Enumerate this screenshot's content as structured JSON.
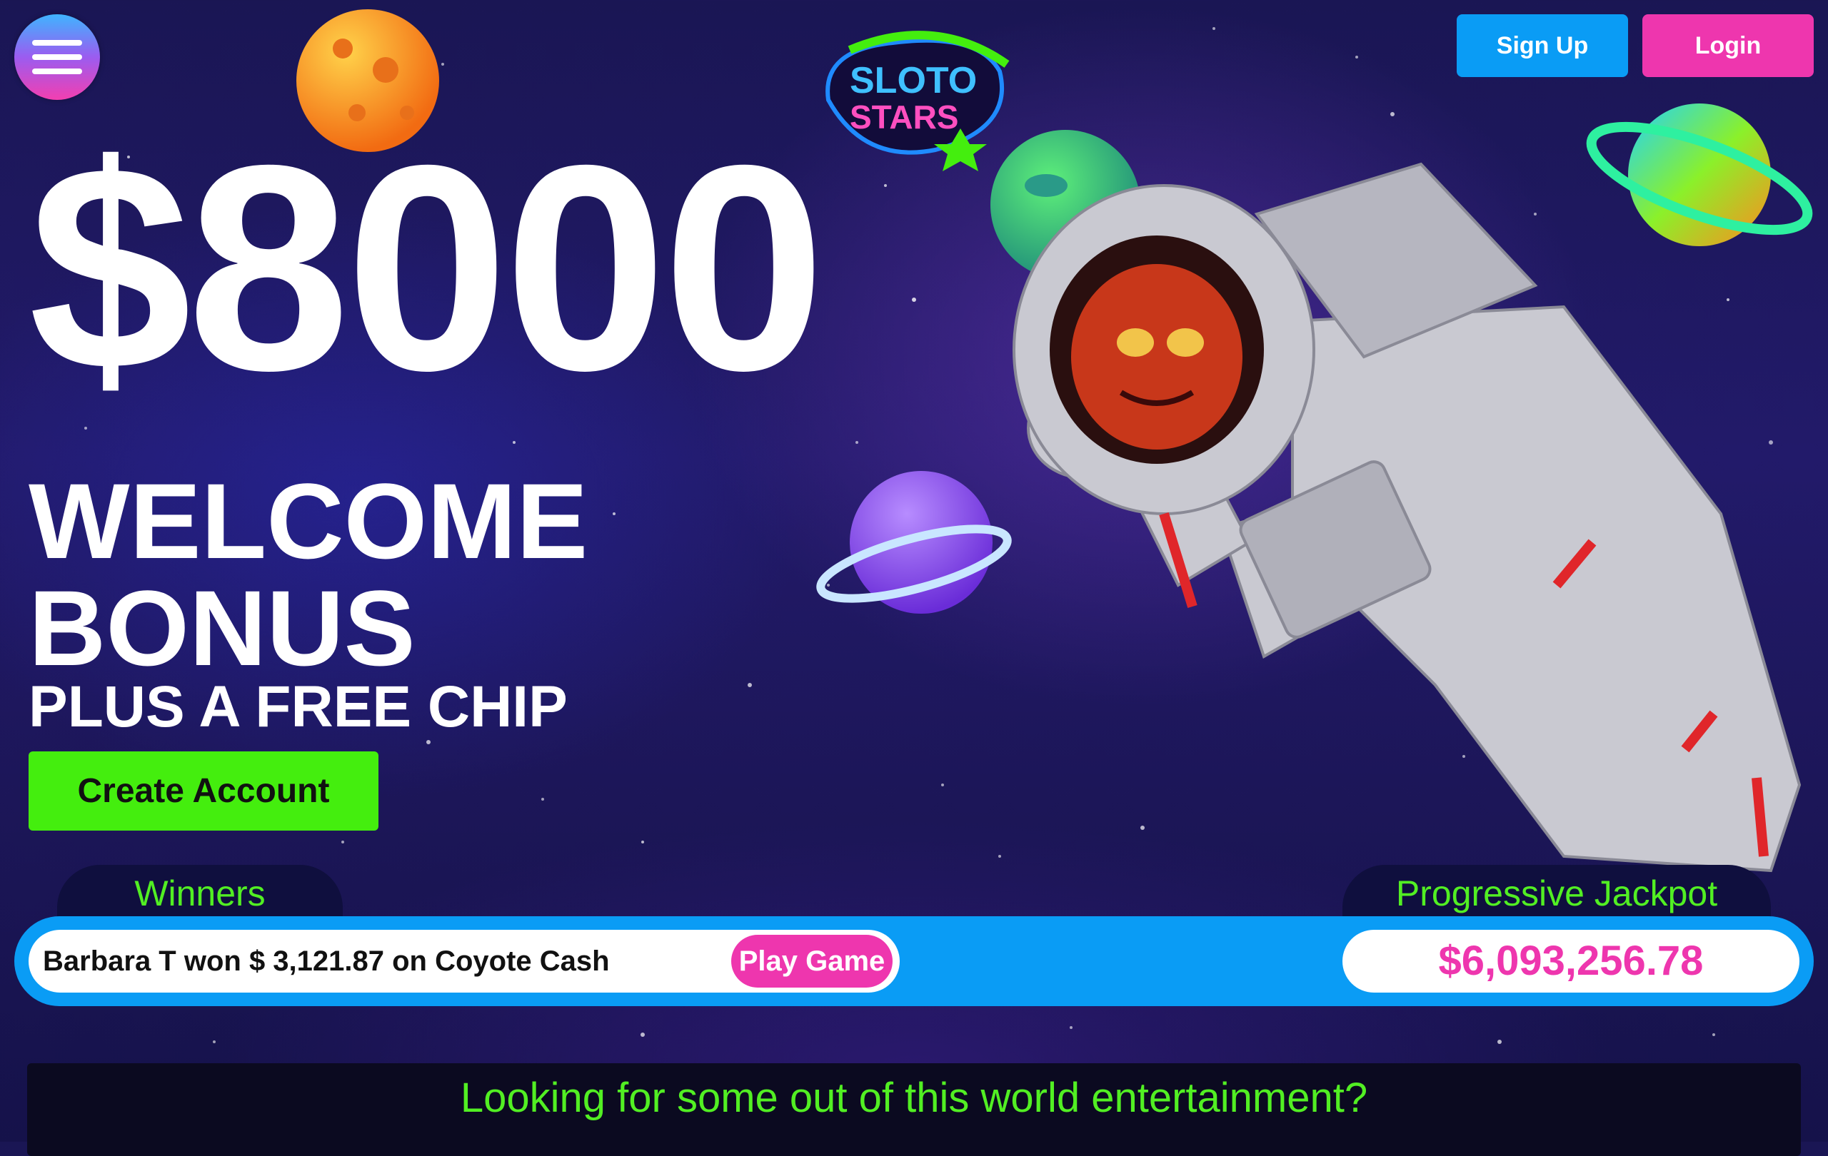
{
  "header": {
    "menu_icon": "hamburger-menu-icon",
    "signup_label": "Sign Up",
    "login_label": "Login",
    "logo_line1": "SLOTO",
    "logo_line2": "STARS"
  },
  "hero": {
    "amount": "$8000",
    "title_line1": "WELCOME",
    "title_line2": "BONUS",
    "subtitle": "PLUS A FREE CHIP",
    "cta_label": "Create Account"
  },
  "ticker": {
    "winners_label": "Winners",
    "winner_text": "Barbara T won $ 3,121.87 on Coyote Cash",
    "play_label": "Play Game",
    "jackpot_label": "Progressive Jackpot",
    "jackpot_value": "$6,093,256.78"
  },
  "section": {
    "heading": "Looking for some out of this world entertainment?"
  },
  "colors": {
    "accent_green": "#52ef23",
    "cta_green": "#44ee0e",
    "brand_pink": "#ee36ae",
    "brand_blue": "#0a9cf5"
  }
}
